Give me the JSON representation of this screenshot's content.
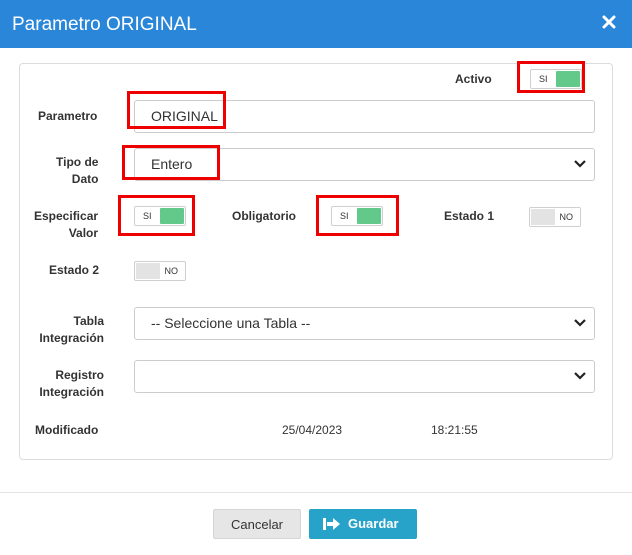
{
  "dialog": {
    "title": "Parametro ORIGINAL"
  },
  "form": {
    "activo_label": "Activo",
    "parametro_label": "Parametro",
    "parametro_value": "ORIGINAL",
    "tipo_dato_label_line1": "Tipo de",
    "tipo_dato_label_line2": "Dato",
    "tipo_dato_value": "Entero",
    "especificar_label_line1": "Especificar",
    "especificar_label_line2": "Valor",
    "obligatorio_label": "Obligatorio",
    "estado1_label": "Estado 1",
    "estado2_label": "Estado 2",
    "tabla_label_line1": "Tabla",
    "tabla_label_line2": "Integración",
    "tabla_value": "-- Seleccione una Tabla --",
    "registro_label_line1": "Registro",
    "registro_label_line2": "Integración",
    "registro_value": "",
    "modificado_label": "Modificado",
    "modificado_date": "25/04/2023",
    "modificado_time": "18:21:55"
  },
  "toggles": {
    "on_text": "SI",
    "off_text": "NO",
    "activo": true,
    "especificar_valor": true,
    "obligatorio": true,
    "estado1": false,
    "estado2": false
  },
  "footer": {
    "cancel_label": "Cancelar",
    "save_label": "Guardar",
    "save_icon": "save-share-icon"
  },
  "colors": {
    "header_bg": "#2a86d8",
    "toggle_on": "#62c98b",
    "highlight": "#ee0000",
    "save_button": "#27a2c8"
  }
}
